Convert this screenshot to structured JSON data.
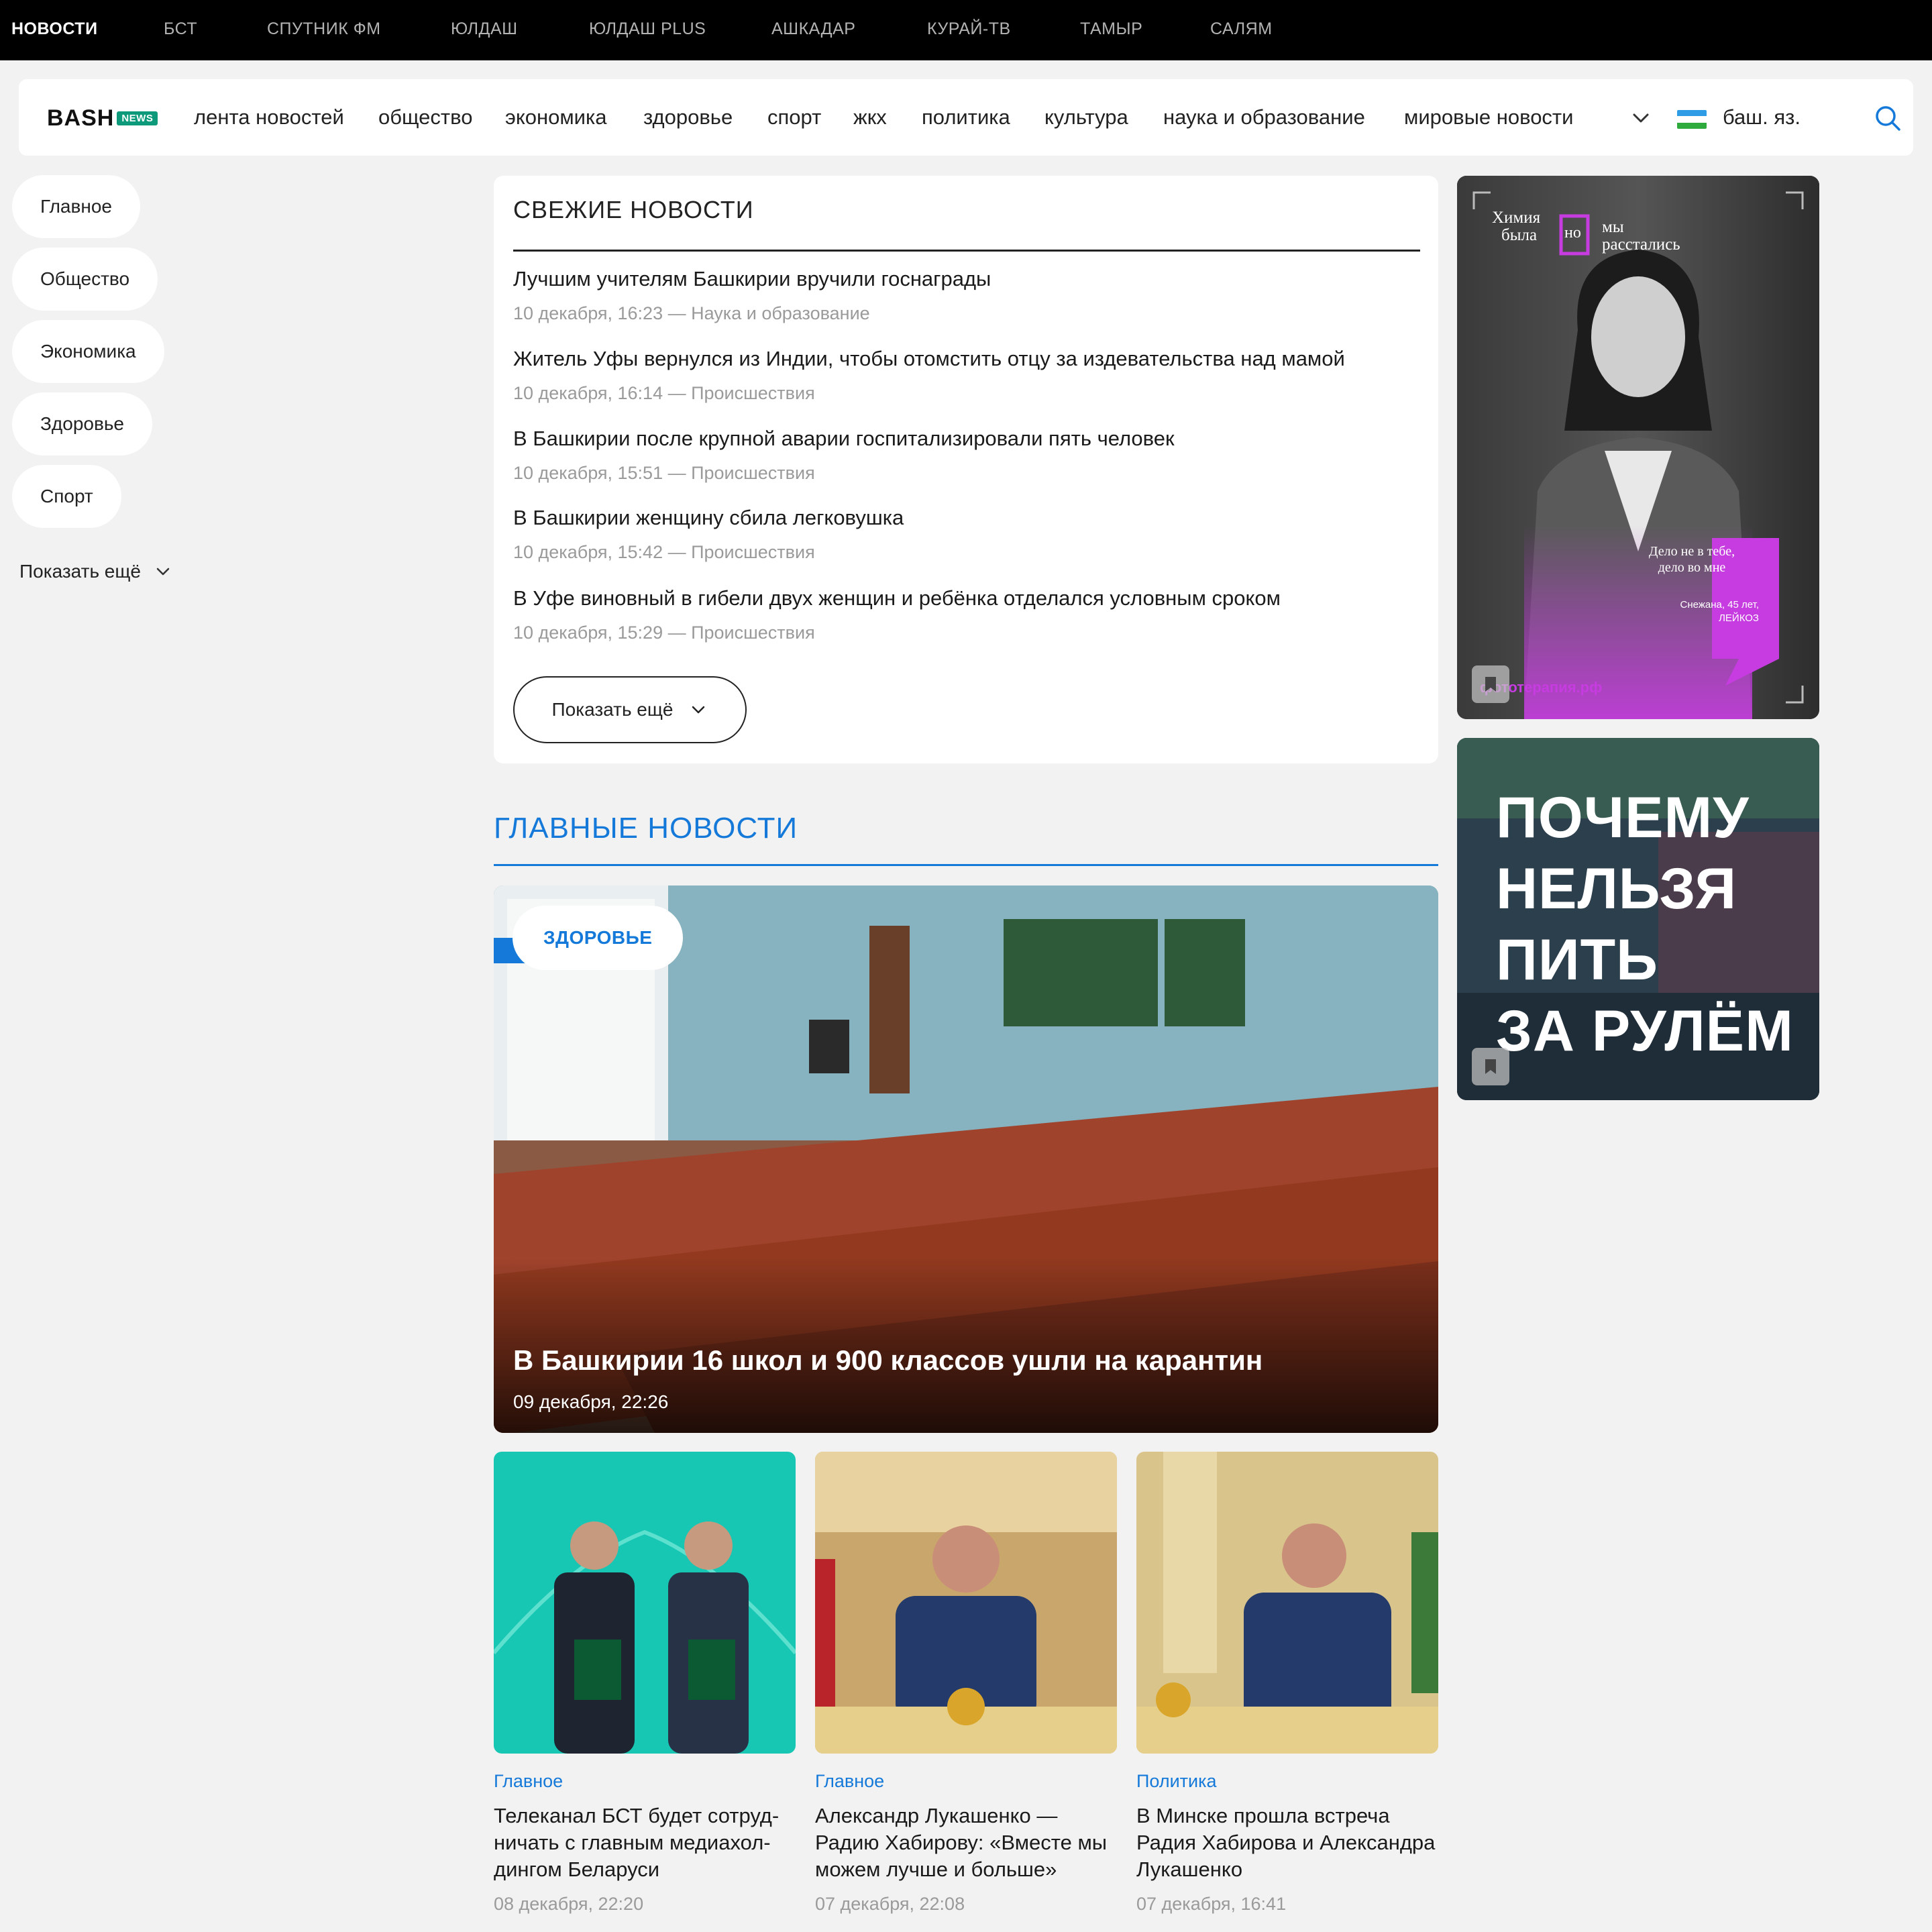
{
  "topbar": {
    "items": [
      "НОВОСТИ",
      "БСТ",
      "СПУТНИК ФМ",
      "ЮЛДАШ",
      "ЮЛДАШ PLUS",
      "АШКАДАР",
      "КУРАЙ-ТВ",
      "ТАМЫР",
      "САЛЯМ"
    ]
  },
  "header": {
    "logo_main": "BASH",
    "logo_badge": "NEWS",
    "nav": [
      "лента новостей",
      "общество",
      "экономика",
      "здоровье",
      "спорт",
      "жкх",
      "политика",
      "культура",
      "наука и образование",
      "мировые новости"
    ],
    "language": "баш. яз.",
    "flag_colors": [
      "#2e9de6",
      "#ffffff",
      "#2faa3c"
    ]
  },
  "sidebar": {
    "items": [
      "Главное",
      "Общество",
      "Экономика",
      "Здоровье",
      "Спорт"
    ],
    "more": "Показать ещё"
  },
  "fresh": {
    "title": "СВЕЖИЕ НОВОСТИ",
    "items": [
      {
        "title": "Лучшим учителям Башкирии вручили госнаграды",
        "meta": "10 декабря, 16:23 —  Наука и образование"
      },
      {
        "title": "Житель Уфы вернулся из Индии, чтобы отомстить отцу за издевательства над мамой",
        "meta": "10 декабря, 16:14 —  Происшествия"
      },
      {
        "title": "В Башкирии после крупной аварии госпитализировали пять человек",
        "meta": "10 декабря, 15:51 —  Происшествия"
      },
      {
        "title": "В Башкирии женщину сбила легковушка",
        "meta": "10 декабря, 15:42 —  Происшествия"
      },
      {
        "title": "В Уфе виновный в гибели двух женщин и ребёнка отделался условным сроком",
        "meta": "10 декабря, 15:29 —  Происшествия"
      }
    ],
    "more": "Показать ещё"
  },
  "main": {
    "title": "ГЛАВНЫЕ НОВОСТИ",
    "hero": {
      "tag": "ЗДОРОВЬЕ",
      "title": "В Башкирии 16 школ и 900 классов ушли на карантин",
      "date": "09 декабря, 22:26"
    },
    "cards": [
      {
        "category": "Главное",
        "title": "Телеканал БСТ будет сотруд-ничать с главным медиахол-дингом Беларуси",
        "date": "08 декабря, 22:20"
      },
      {
        "category": "Главное",
        "title": "Александр Лукашенко — Радию Хабирову: «Вместе мы можем лучше и больше»",
        "date": "07 декабря, 22:08"
      },
      {
        "category": "Политика",
        "title": "В Минске прошла встреча Радия Хабирова и Александра Лукашенко",
        "date": "07 декабря, 16:41"
      }
    ]
  },
  "ads": {
    "ad1": {
      "headline_1": "Химия",
      "headline_2": "была",
      "headline_no": "но",
      "headline_3": "мы",
      "headline_4": "расстались",
      "quote_1": "Дело не в тебе,",
      "quote_2": "дело во мне",
      "signature_1": "Снежана, 45 лет,",
      "signature_2": "ЛЕЙКОЗ",
      "site": "фототерапия.рф"
    },
    "ad2": {
      "lines": [
        "ПОЧЕМУ",
        "НЕЛЬЗЯ",
        "ПИТЬ",
        "ЗА РУЛЁМ"
      ]
    }
  },
  "colors": {
    "accent": "#1479d9",
    "ad_magenta": "#c63ce0",
    "logo_badge": "#0c9a7a"
  }
}
